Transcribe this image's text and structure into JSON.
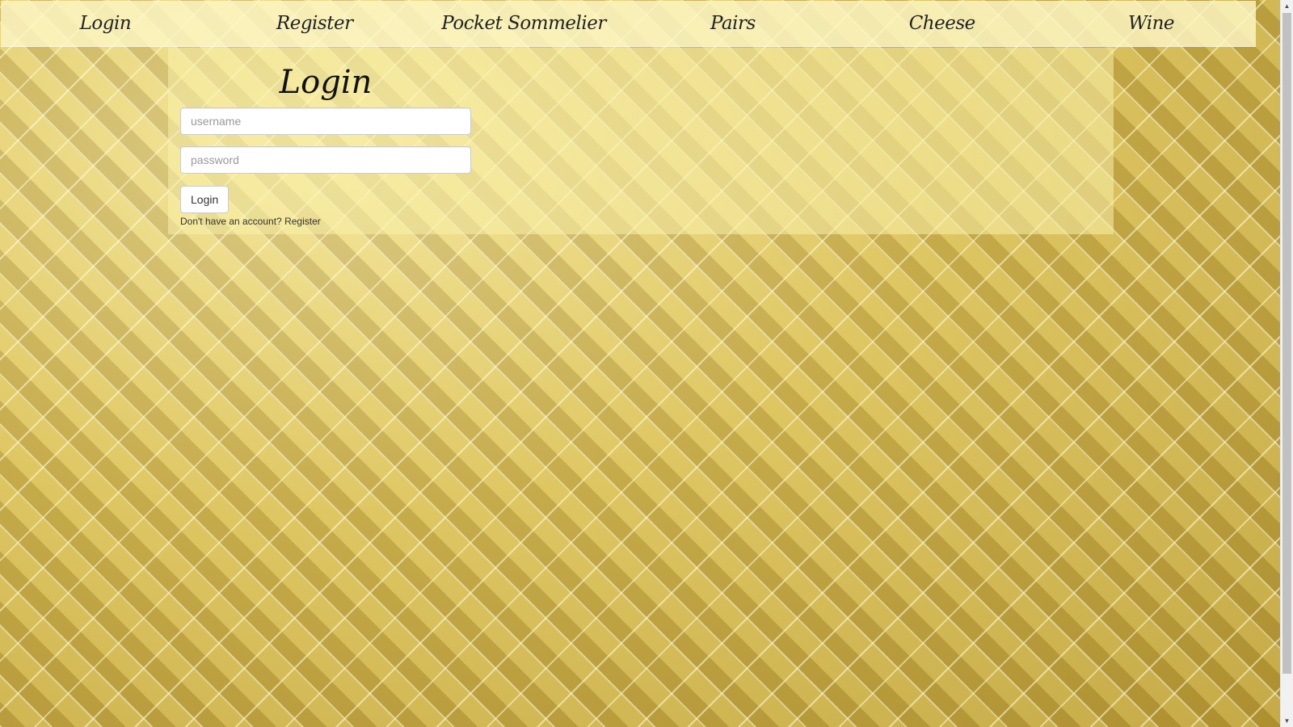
{
  "nav": {
    "items": [
      {
        "label": "Login"
      },
      {
        "label": "Register"
      },
      {
        "label": "Pocket Sommelier"
      },
      {
        "label": "Pairs"
      },
      {
        "label": "Cheese"
      },
      {
        "label": "Wine"
      }
    ]
  },
  "login": {
    "title": "Login",
    "username_placeholder": "username",
    "password_placeholder": "password",
    "submit_label": "Login",
    "no_account_text": "Don't have an account?",
    "register_link": "Register"
  },
  "scrollbar": {
    "up_icon": "▲",
    "down_icon": "▼"
  }
}
